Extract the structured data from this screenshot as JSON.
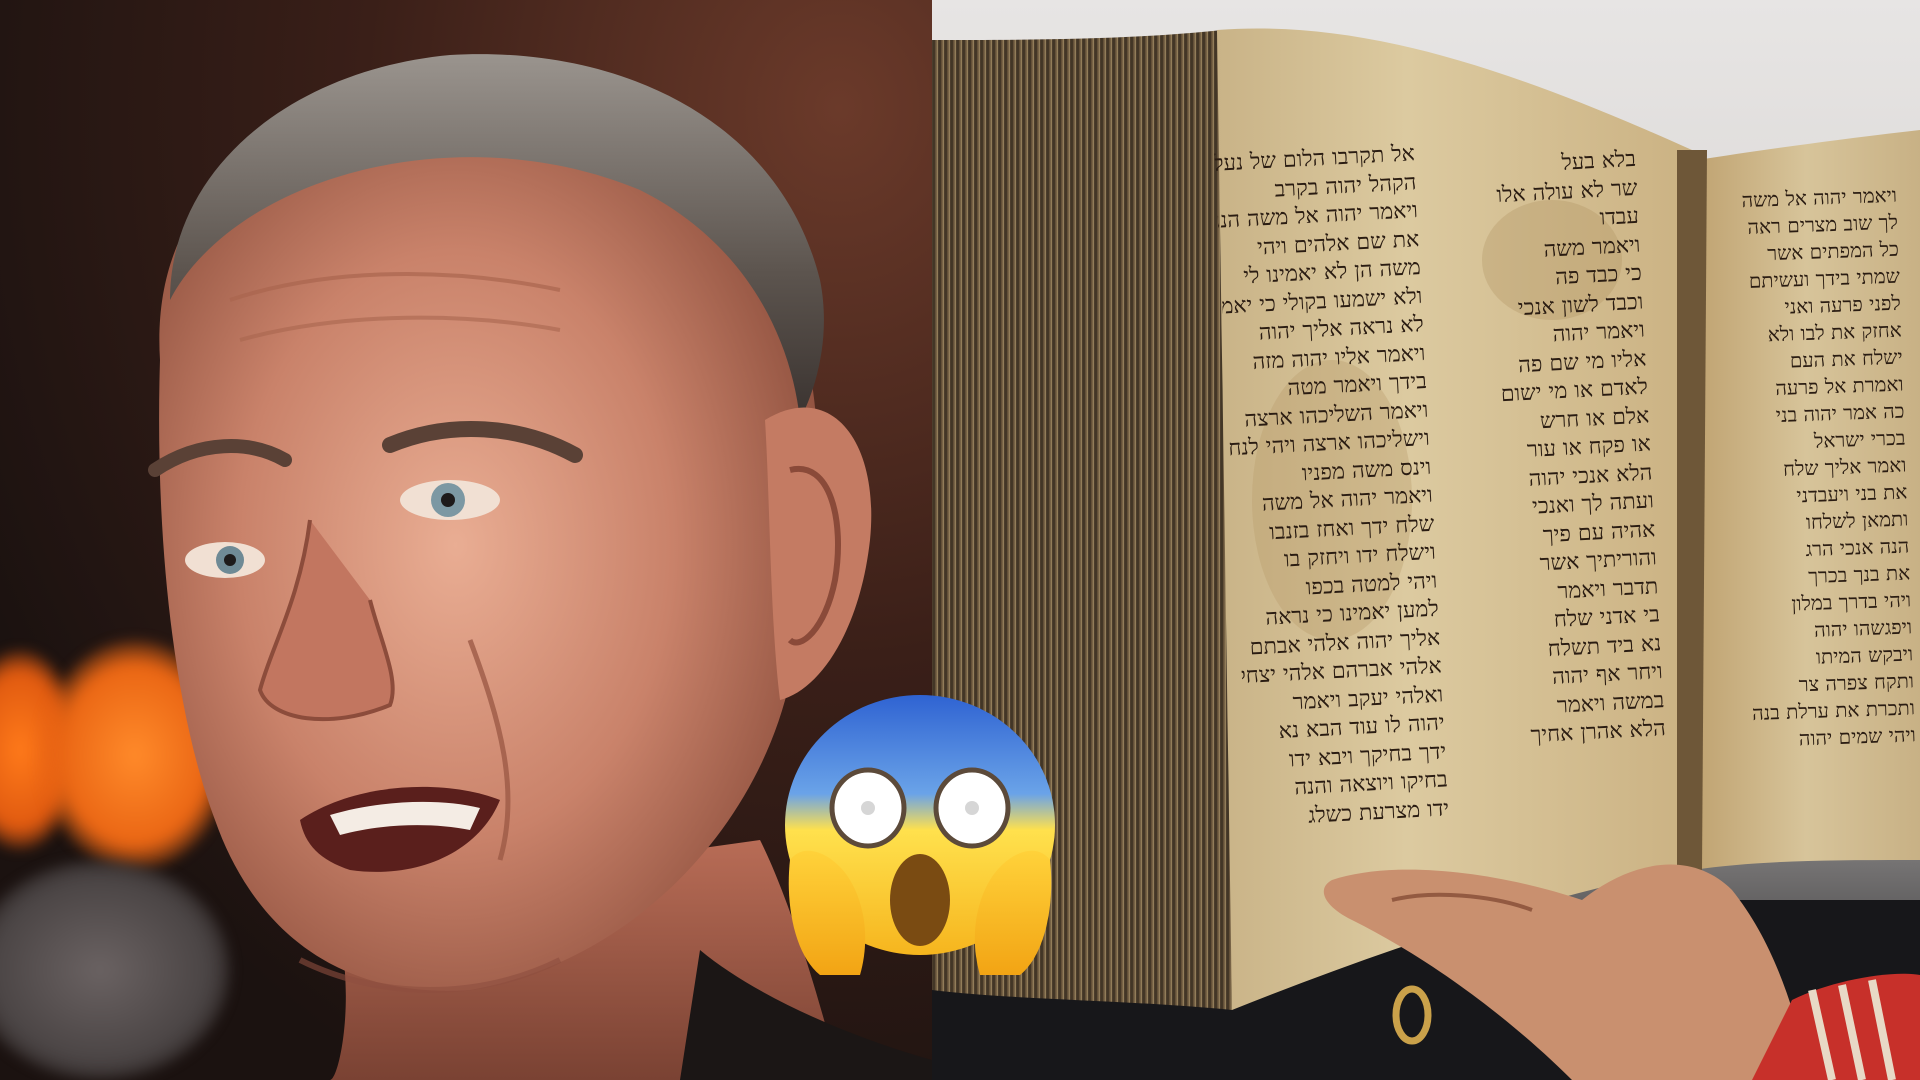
{
  "scene": {
    "layout": "two-panel collage",
    "left_panel": "portrait",
    "right_panel": "open ancient Hebrew manuscript",
    "overlay": "face-screaming-in-fear emoji"
  },
  "manuscript": {
    "column_right_page": [
      "אל תקרבו הלום של נעליך",
      "הקהל יהוה בקרב",
      "ויאמר יהוה אל משה הנני",
      "את שם אלהים ויהי",
      "משה הן לא יאמינו לי",
      "ולא ישמעו בקולי כי יאמרו",
      "לא נראה אליך יהוה",
      "ויאמר אליו יהוה מזה",
      "בידך ויאמר מטה",
      "ויאמר השליכהו ארצה",
      "וישליכהו ארצה ויהי לנחש",
      "וינס משה מפניו",
      "ויאמר יהוה אל משה",
      "שלח ידך ואחז בזנבו",
      "וישלח ידו ויחזק בו",
      "ויהי למטה בכפו",
      "למען יאמינו כי נראה",
      "אליך יהוה אלהי אבתם",
      "אלהי אברהם אלהי יצחק",
      "ואלהי יעקב ויאמר",
      "יהוה לו עוד הבא נא",
      "ידך בחיקך ויבא ידו",
      "בחיקו ויוצאה והנה",
      "ידו מצרעת כשלג"
    ],
    "column_middle": [
      "בלא בעל",
      "שר לא עולה אלו",
      "עבדו",
      "ויאמר משה",
      "כי כבד פה",
      "וכבד לשון אנכי",
      "ויאמר יהוה",
      "אליו מי שם פה",
      "לאדם או מי ישום",
      "אלם או חרש",
      "או פקח או עור",
      "הלא אנכי יהוה",
      "ועתה לך ואנכי",
      "אהיה עם פיך",
      "והוריתיך אשר",
      "תדבר ויאמר",
      "בי אדני שלח",
      "נא ביד תשלח",
      "ויחר אף יהוה",
      "במשה ויאמר",
      "הלא אהרן אחיך"
    ],
    "column_left_page": [
      "ויאמר יהוה אל משה",
      "לך שוב מצרים ראה",
      "כל המפתים אשר",
      "שמתי בידך ועשיתם",
      "לפני פרעה ואני",
      "אחזק את לבו ולא",
      "ישלח את העם",
      "ואמרת אל פרעה",
      "כה אמר יהוה בני",
      "בכרי ישראל",
      "ואמר אליך שלח",
      "את בני ויעבדני",
      "ותמאן לשלחו",
      "הנה אנכי הרג",
      "את בנך בכרך",
      "ויהי בדרך במלון",
      "ויפגשהו יהוה",
      "ויבקש המיתו",
      "ותקח צפרה צר",
      "ותכרת את ערלת בנה",
      "ויהי שמים יהוה"
    ]
  },
  "colors": {
    "background_left": "#3a1f18",
    "background_right": "#e7e5e4",
    "parchment": "#d9c49a",
    "ink": "#2a1c12",
    "emoji_face": "#ffd23a",
    "emoji_top": "#3b6fd6"
  }
}
